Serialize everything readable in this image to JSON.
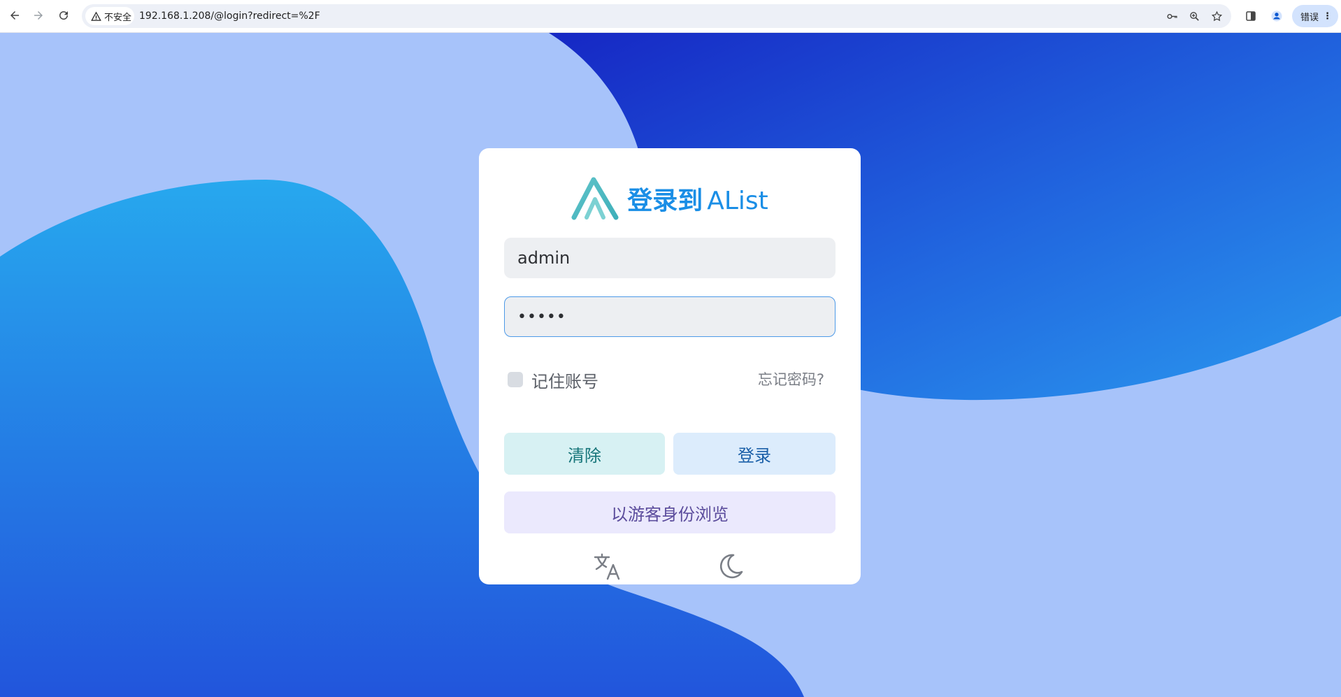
{
  "browser": {
    "security_label": "不安全",
    "url": "192.168.1.208/@login?redirect=%2F",
    "error_label": "错误",
    "icons": [
      "back-icon",
      "forward-icon",
      "reload-icon",
      "warning-icon",
      "key-icon",
      "zoom-icon",
      "star-icon",
      "side-panel-icon",
      "profile-icon",
      "more-icon"
    ]
  },
  "login": {
    "title": "登录到",
    "brand": "AList",
    "username_value": "admin",
    "password_value": "•••••",
    "remember_label": "记住账号",
    "forgot_label": "忘记密码?",
    "clear_label": "清除",
    "login_label": "登录",
    "guest_label": "以游客身份浏览",
    "icons": [
      "translate-icon",
      "dark-mode-moon-icon"
    ]
  },
  "colors": {
    "page_bg": "#a7c3fa",
    "brand_blue": "#1a8ee6",
    "clear_bg": "#d7f1f3",
    "login_bg": "#dcecfc",
    "guest_bg": "#ebe9fd"
  }
}
